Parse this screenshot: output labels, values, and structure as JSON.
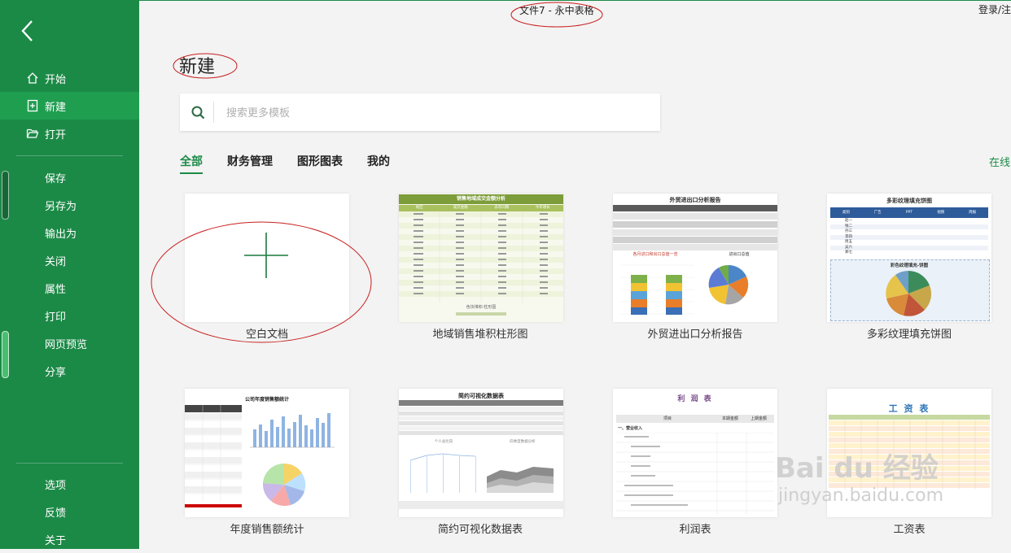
{
  "window": {
    "title": "文件7 - 永中表格",
    "login": "登录/注"
  },
  "sidebar": {
    "nav": [
      {
        "label": "开始",
        "icon": "home-icon"
      },
      {
        "label": "新建",
        "icon": "new-file-icon"
      },
      {
        "label": "打开",
        "icon": "folder-open-icon"
      }
    ],
    "file_actions": [
      "保存",
      "另存为",
      "输出为",
      "关闭",
      "属性",
      "打印",
      "网页预览",
      "分享"
    ],
    "bottom": [
      "选项",
      "反馈",
      "关于"
    ]
  },
  "page": {
    "heading": "新建"
  },
  "search": {
    "placeholder": "搜索更多模板",
    "value": ""
  },
  "tabs": [
    "全部",
    "财务管理",
    "图形图表",
    "我的"
  ],
  "online_link": "在线",
  "templates": [
    {
      "label": "空白文档"
    },
    {
      "label": "地域销售堆积柱形图",
      "title": "销售地域成交金额分析",
      "cols": [
        "地区",
        "成交金额",
        "去年同期",
        "今年增长"
      ],
      "caption": "色块堆积·柱形图"
    },
    {
      "label": "外贸进出口分析报告",
      "title": "外贸进出口分析报告",
      "sub1": "各月进口和出口总值一览",
      "sub2": "进出口总值"
    },
    {
      "label": "多彩纹理填充饼图",
      "title": "多彩纹理填充饼图",
      "sub": "彩色纹理填充-饼图",
      "cols": [
        "类别",
        "广告",
        "PPT",
        "视频",
        "周报"
      ],
      "rows": [
        "赵一",
        "钱二",
        "孙三",
        "李四",
        "周五",
        "吴六",
        "郑七"
      ]
    },
    {
      "label": "年度销售额统计",
      "title": "公司年度销售额统计"
    },
    {
      "label": "简约可视化数据表",
      "title": "简约可视化数据表",
      "sub1": "个人总比较",
      "sub2": "四季度数据分析"
    },
    {
      "label": "利润表",
      "title": "利 润 表",
      "col1": "项目",
      "col2": "本期金额",
      "col3": "上期金额",
      "row1": "一、营业收入"
    },
    {
      "label": "工资表",
      "title": "工 资 表"
    }
  ],
  "watermark": {
    "logo": "Bai du 经验",
    "url": "jingyan.baidu.com"
  },
  "colors": {
    "accent": "#1c8a47",
    "active_nav": "#1f9e50",
    "annotation": "#c81e1e"
  }
}
